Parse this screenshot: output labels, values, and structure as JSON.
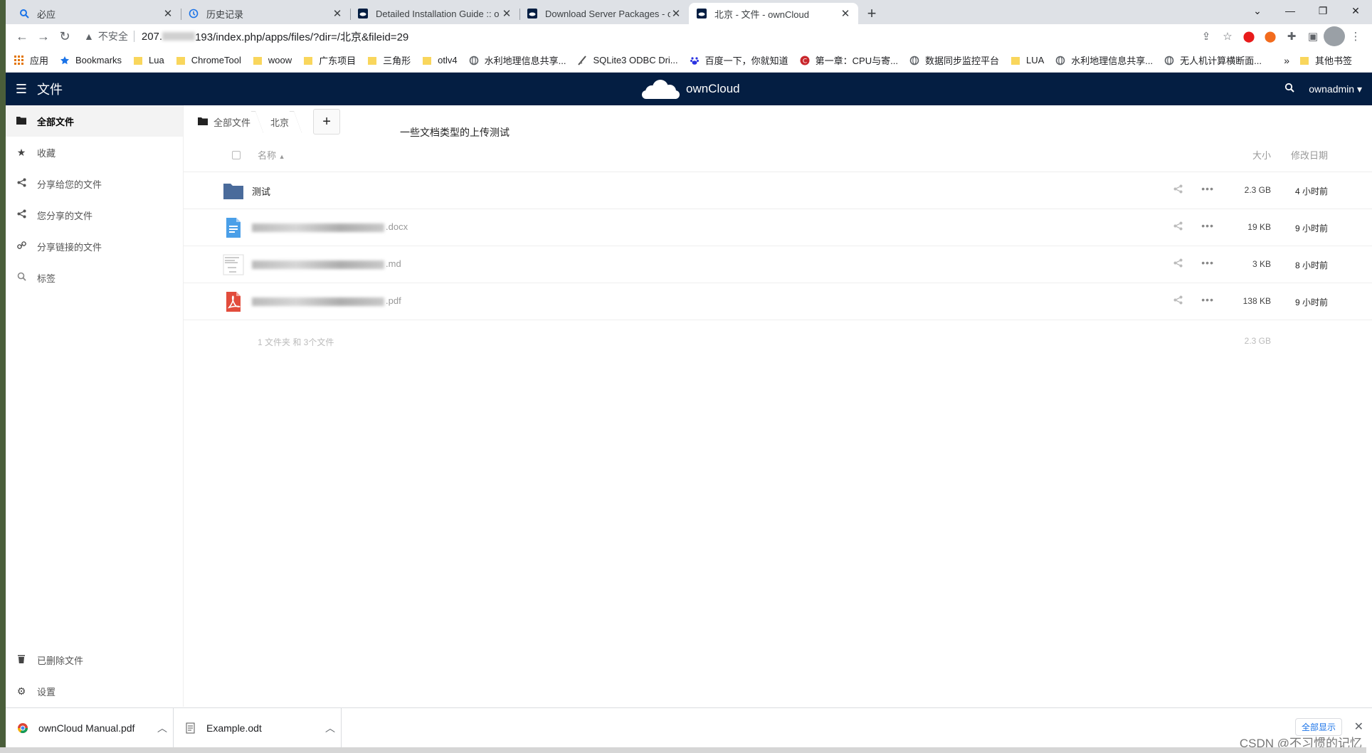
{
  "tabs": [
    {
      "title": "必应",
      "icon": "search-icon",
      "active": false
    },
    {
      "title": "历史记录",
      "icon": "history-icon",
      "active": false
    },
    {
      "title": "Detailed Installation Guide :: o",
      "icon": "owncloud-favicon",
      "active": false
    },
    {
      "title": "Download Server Packages - o",
      "icon": "owncloud-favicon",
      "active": false
    },
    {
      "title": "北京 - 文件 - ownCloud",
      "icon": "owncloud-favicon",
      "active": true
    }
  ],
  "toolbar": {
    "security_label": "不安全",
    "url_prefix": "207.",
    "url_suffix": "193/index.php/apps/files/?dir=/北京&fileid=29"
  },
  "bookmarks": [
    {
      "label": "应用",
      "icon": "apps-grid-icon"
    },
    {
      "label": "Bookmarks",
      "icon": "star-icon"
    },
    {
      "label": "Lua",
      "icon": "folder-icon"
    },
    {
      "label": "ChromeTool",
      "icon": "folder-icon"
    },
    {
      "label": "woow",
      "icon": "folder-icon"
    },
    {
      "label": "广东项目",
      "icon": "folder-icon"
    },
    {
      "label": "三角形",
      "icon": "folder-icon"
    },
    {
      "label": "otlv4",
      "icon": "folder-icon"
    },
    {
      "label": "水利地理信息共享...",
      "icon": "globe-icon"
    },
    {
      "label": "SQLite3 ODBC Dri...",
      "icon": "sqlite-icon"
    },
    {
      "label": "百度一下，你就知道",
      "icon": "baidu-icon"
    },
    {
      "label": "第一章：CPU与寄...",
      "icon": "csdn-icon"
    },
    {
      "label": "数据同步监控平台",
      "icon": "globe-icon"
    },
    {
      "label": "LUA",
      "icon": "folder-icon"
    },
    {
      "label": "水利地理信息共享...",
      "icon": "globe-icon"
    },
    {
      "label": "无人机计算横断面...",
      "icon": "globe-icon"
    }
  ],
  "bookmarks_more": "»",
  "bookmarks_other": "其他书签",
  "header": {
    "app_name": "文件",
    "brand": "ownCloud",
    "user": "ownadmin"
  },
  "sidebar": {
    "items": [
      {
        "label": "全部文件",
        "icon": "folder-icon",
        "active": true
      },
      {
        "label": "收藏",
        "icon": "star-icon",
        "active": false
      },
      {
        "label": "分享给您的文件",
        "icon": "share-icon",
        "active": false
      },
      {
        "label": "您分享的文件",
        "icon": "share-icon",
        "active": false
      },
      {
        "label": "分享链接的文件",
        "icon": "link-icon",
        "active": false
      },
      {
        "label": "标签",
        "icon": "search-icon",
        "active": false
      }
    ],
    "bottom": [
      {
        "label": "已删除文件",
        "icon": "trash-icon"
      },
      {
        "label": "设置",
        "icon": "gear-icon"
      }
    ]
  },
  "breadcrumb": [
    {
      "label": "全部文件"
    },
    {
      "label": "北京"
    }
  ],
  "note": "一些文档类型的上传测试",
  "table": {
    "col_name": "名称",
    "col_size": "大小",
    "col_date": "修改日期",
    "rows": [
      {
        "name": "测试",
        "ext": "",
        "type": "folder",
        "size": "2.3 GB",
        "date": "4 小时前"
      },
      {
        "name": "",
        "ext": ".docx",
        "type": "docx",
        "size": "19 KB",
        "date": "9 小时前"
      },
      {
        "name": "",
        "ext": ".md",
        "type": "md",
        "size": "3 KB",
        "date": "8 小时前"
      },
      {
        "name": "",
        "ext": ".pdf",
        "type": "pdf",
        "size": "138 KB",
        "date": "9 小时前"
      }
    ],
    "summary_count": "1 文件夹 和 3个文件",
    "summary_size": "2.3 GB"
  },
  "downloads": [
    {
      "name": "ownCloud Manual.pdf",
      "icon": "chrome-icon"
    },
    {
      "name": "Example.odt",
      "icon": "document-icon"
    }
  ],
  "downloads_show_all": "全部显示",
  "watermark": "CSDN @不习惯的记忆",
  "colors": {
    "header_bg": "#041e42",
    "folder": "#4a6b9b",
    "docx": "#4a9fe8",
    "pdf": "#e24c3c"
  }
}
